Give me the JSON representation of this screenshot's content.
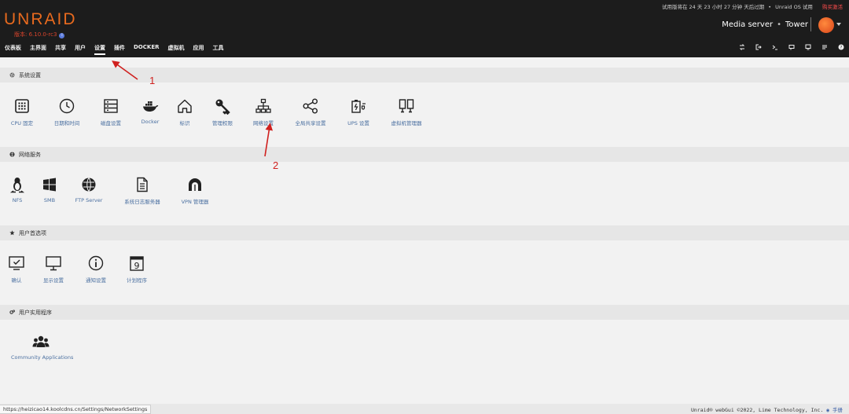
{
  "header": {
    "logo": "UNRAID",
    "version": "版本: 6.10.0-rc3",
    "trial_text": "试用版将在 24 天 23 小时 27 分钟 天后过期",
    "os_label": "Unraid OS 试用",
    "buy_label": "购买激活",
    "server_desc": "Media server",
    "server_name": "Tower"
  },
  "nav": {
    "items": [
      "仪表板",
      "主界面",
      "共享",
      "用户",
      "设置",
      "插件",
      "DOCKER",
      "虚拟机",
      "应用",
      "工具"
    ],
    "active": "设置"
  },
  "toolbar": {
    "icons": [
      "swap-icon",
      "logout-icon",
      "terminal-icon",
      "feedback-icon",
      "monitor-icon",
      "log-icon",
      "help-icon"
    ]
  },
  "sections": {
    "system": {
      "title": "系统设置",
      "items": [
        "CPU 固定",
        "日期和时间",
        "磁盘设置",
        "Docker",
        "标识",
        "管理权限",
        "网络设置",
        "全局共享设置",
        "UPS 设置",
        "虚拟机管理器"
      ]
    },
    "network": {
      "title": "网络服务",
      "items": [
        "NFS",
        "SMB",
        "FTP Server",
        "系统日志服务器",
        "VPN 管理器"
      ]
    },
    "user": {
      "title": "用户首选项",
      "items": [
        "确认",
        "显示设置",
        "通知设置",
        "计划程序"
      ]
    },
    "utilities": {
      "title": "用户实用程序",
      "items": [
        "Community Applications"
      ]
    }
  },
  "annotations": {
    "one": "1",
    "two": "2"
  },
  "footer": {
    "url": "https://heizicao14.koolcdns.cn/Settings/NetworkSettings",
    "copyright": "Unraid® webGui ©2022, Lime Technology, Inc.",
    "manual": "手册"
  },
  "colors": {
    "header_bg": "#1c1c1c",
    "brand": "#e86a1e",
    "link": "#4a6fa0",
    "annotation": "#d0201e"
  }
}
